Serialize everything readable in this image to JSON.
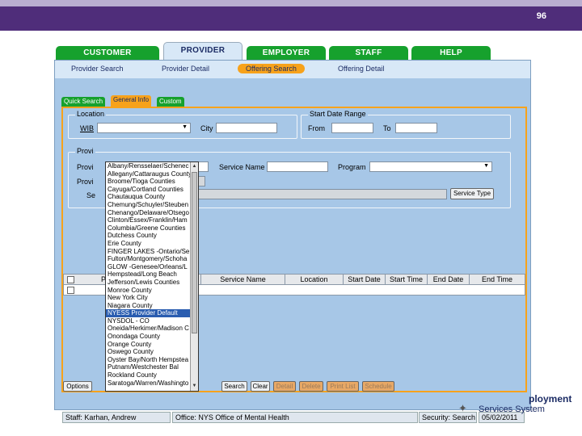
{
  "slide": {
    "number": "96"
  },
  "nav": {
    "tabs": [
      "CUSTOMER",
      "PROVIDER",
      "EMPLOYER",
      "STAFF",
      "HELP"
    ],
    "active_tab": "PROVIDER",
    "subnav": [
      "Provider Search",
      "Provider Detail",
      "Offering Search",
      "Offering Detail"
    ],
    "active_subnav": "Offering Search"
  },
  "inner_tabs": [
    "Quick Search",
    "General Info",
    "Custom"
  ],
  "location": {
    "legend": "Location",
    "wib_label": "WIB",
    "city_label": "City"
  },
  "start_date_range": {
    "legend": "Start Date Range",
    "from_label": "From",
    "to_label": "To"
  },
  "provider_group": {
    "legend": "Provi",
    "provider_label": "Provi",
    "provider_label2": "Provi",
    "service_label": "Se",
    "service_name_label": "Service Name",
    "program_label": "Program",
    "service_type_button": "Service Type"
  },
  "wib_dropdown": {
    "items": [
      "Albany/Rensselaer/Schenec",
      "Allegany/Cattaraugus County",
      "Broome/Tioga Counties",
      "Cayuga/Cortland Counties",
      "Chautauqua County",
      "Chemung/Schuyler/Steuben",
      "Chenango/Delaware/Otsego",
      "Clinton/Essex/Franklin/Ham",
      "Columbia/Greene Counties",
      "Dutchess County",
      "Erie County",
      "FINGER LAKES -Ontario/Se",
      "Fulton/Montgomery/Schoha",
      "GLOW -Genesee/Orleans/L",
      "Hempstead/Long Beach",
      "Jefferson/Lewis Counties",
      "Monroe County",
      "New York City",
      "Niagara County",
      "NYESS Provider Default",
      "NYSDOL - CO",
      "Oneida/Herkimer/Madison C",
      "Onondaga County",
      "Orange County",
      "Oswego County",
      "Oyster Bay/North Hempstea",
      "Putnam/Westchester Bal",
      "Rockland County",
      "Saratoga/Warren/Washingto"
    ],
    "selected": "NYESS Provider Default"
  },
  "results_grid": {
    "columns": [
      "P",
      "Service Name",
      "Location",
      "Start Date",
      "Start Time",
      "End Date",
      "End Time"
    ]
  },
  "buttons": {
    "options": "Options",
    "search": "Search",
    "clear": "Clear",
    "detail": "Detail",
    "delete": "Delete",
    "print_list": "Print List",
    "schedule": "Schedule"
  },
  "status": {
    "staff": "Staff: Karhan, Andrew",
    "office": "Office: NYS Office of Mental Health",
    "security": "Security: Search",
    "date": "05/02/2011"
  },
  "logo": {
    "line1": "ployment",
    "line2": "Services System"
  }
}
